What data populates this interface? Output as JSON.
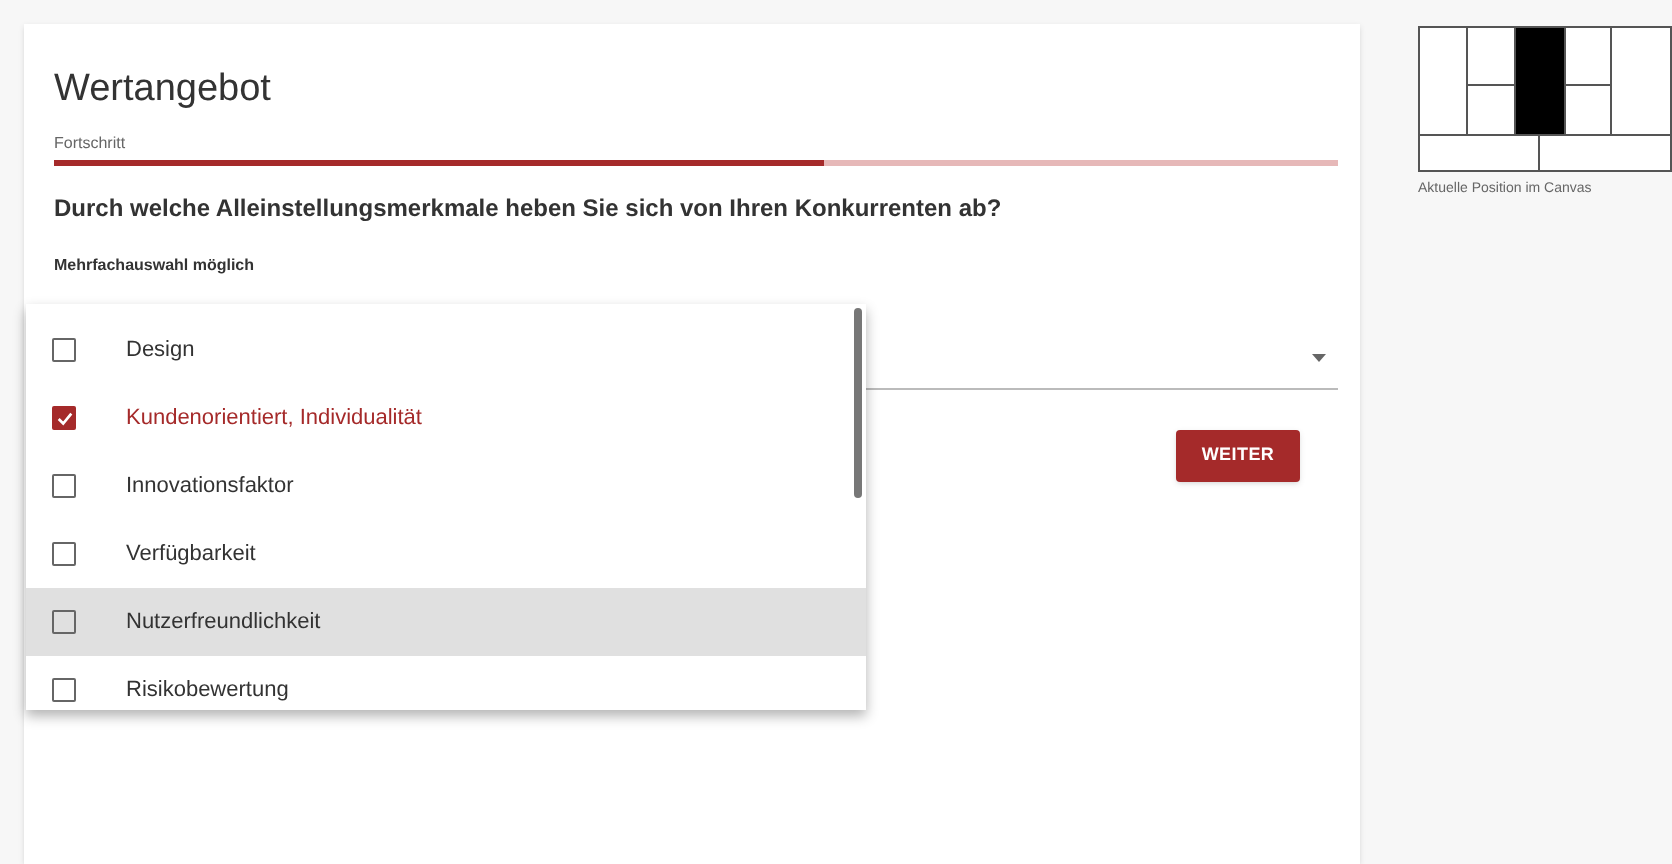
{
  "title": "Wertangebot",
  "progress": {
    "label": "Fortschritt",
    "level": 0.6
  },
  "question": "Durch welche Alleinstellungsmerkmale heben Sie sich von Ihren Konkurrenten ab?",
  "hint": "Mehrfachauswahl möglich",
  "options": [
    {
      "label": "Design",
      "checked": false,
      "hovered": false
    },
    {
      "label": "Kundenorientiert, Individualität",
      "checked": true,
      "hovered": false
    },
    {
      "label": "Innovationsfaktor",
      "checked": false,
      "hovered": false
    },
    {
      "label": "Verfügbarkeit",
      "checked": false,
      "hovered": false
    },
    {
      "label": "Nutzerfreundlichkeit",
      "checked": false,
      "hovered": true
    },
    {
      "label": "Risikobewertung",
      "checked": false,
      "hovered": false
    }
  ],
  "next_button": "WEITER",
  "canvas_map": {
    "caption": "Aktuelle Position im Canvas",
    "cells": [
      {
        "selected": false
      },
      {
        "selected": false
      },
      {
        "selected": false
      },
      {
        "selected": true
      },
      {
        "selected": false
      },
      {
        "selected": false
      },
      {
        "selected": false
      },
      {
        "selected": false
      },
      {
        "selected": false
      }
    ]
  }
}
